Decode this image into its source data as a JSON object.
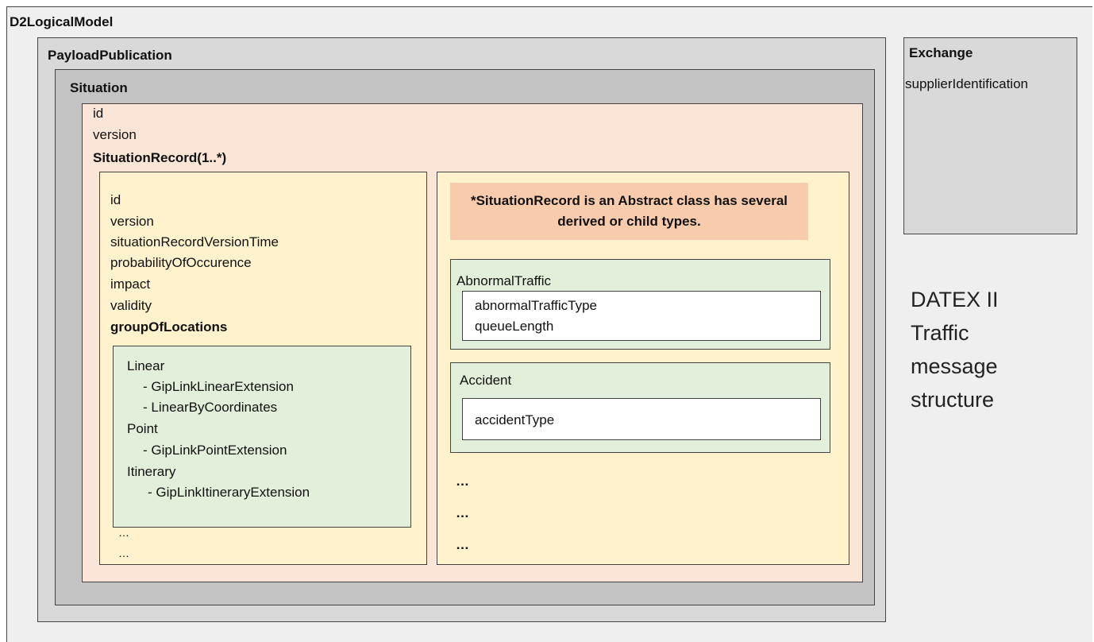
{
  "diagram": {
    "root_title": "D2LogicalModel",
    "payload_title": "PayloadPublication",
    "situation": {
      "title": "Situation",
      "attributes": [
        "id",
        "version"
      ],
      "record_heading": "SituationRecord(1..*)"
    },
    "situation_record": {
      "attributes": [
        "id",
        "version",
        "situationRecordVersionTime",
        "probabilityOfOccurence",
        "impact",
        "validity"
      ],
      "group_heading": "groupOfLocations",
      "locations": [
        "Linear",
        "- GipLinkLinearExtension",
        "- LinearByCoordinates",
        "Point",
        "- GipLinkPointExtension",
        "Itinerary",
        "- GipLinkItineraryExtension"
      ],
      "ellipses": [
        "…",
        "…"
      ]
    },
    "note": "*SituationRecord is an Abstract class has several derived or child types.",
    "abnormal_traffic": {
      "title": "AbnormalTraffic",
      "attributes": [
        "abnormalTrafficType",
        "queueLength"
      ]
    },
    "accident": {
      "title": "Accident",
      "attributes": [
        "accidentType"
      ]
    },
    "more_types": [
      "…",
      "…",
      "…"
    ],
    "exchange": {
      "title": "Exchange",
      "attributes": [
        "supplierIdentification"
      ]
    },
    "caption_lines": [
      "DATEX II",
      "Traffic",
      "message",
      "structure"
    ]
  }
}
